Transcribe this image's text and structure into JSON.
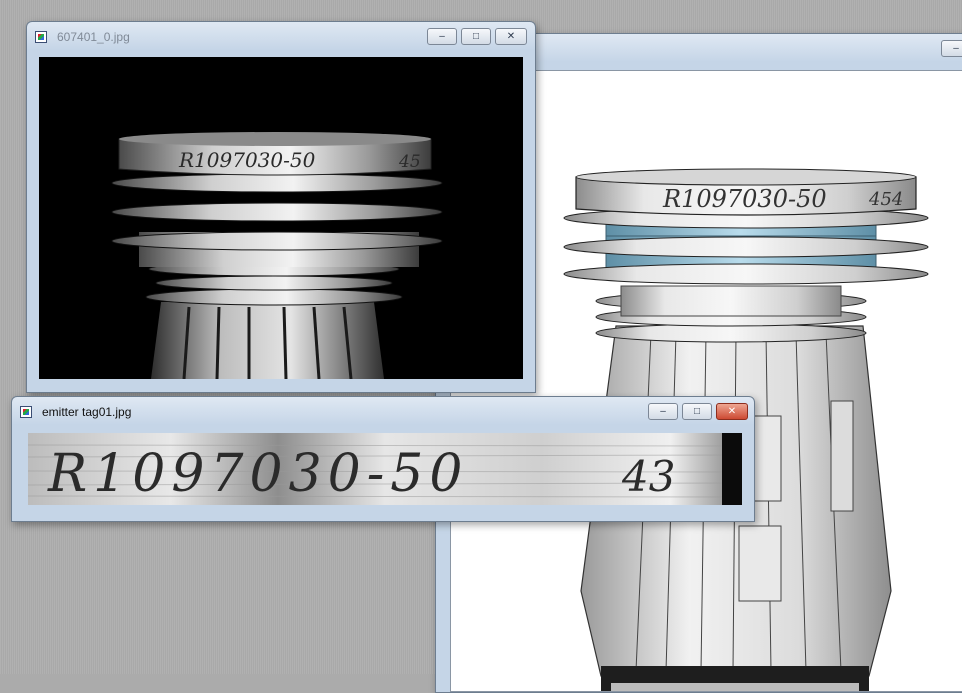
{
  "windows": {
    "back": {
      "title": ""
    },
    "photo": {
      "title": "607401_0.jpg"
    },
    "tag": {
      "title": "emitter tag01.jpg"
    }
  },
  "engraving": {
    "text": "R1097030-50",
    "number": "454",
    "photo_number": "45",
    "tag_number": "43"
  },
  "controls": {
    "minimize": "–",
    "maximize": "□",
    "close": "✕"
  },
  "icons": {
    "file": "image-file-icon"
  }
}
